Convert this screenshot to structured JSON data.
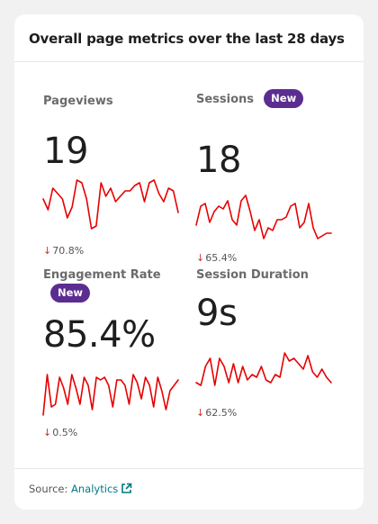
{
  "header": {
    "title": "Overall page metrics over the last 28 days"
  },
  "metrics": [
    {
      "label": "Pageviews",
      "badge": "",
      "value": "19",
      "change": "70.8%",
      "trend": "down",
      "sparkline": [
        0.65,
        0.45,
        0.85,
        0.75,
        0.65,
        0.3,
        0.5,
        1.0,
        0.95,
        0.65,
        0.1,
        0.15,
        0.95,
        0.7,
        0.85,
        0.6,
        0.7,
        0.8,
        0.8,
        0.9,
        0.95,
        0.6,
        0.95,
        1.0,
        0.75,
        0.6,
        0.85,
        0.8,
        0.4
      ]
    },
    {
      "label": "Sessions",
      "badge": "New",
      "value": "18",
      "change": "65.4%",
      "trend": "down",
      "sparkline": [
        0.3,
        0.65,
        0.7,
        0.35,
        0.55,
        0.65,
        0.6,
        0.75,
        0.4,
        0.3,
        0.75,
        0.85,
        0.55,
        0.2,
        0.4,
        0.05,
        0.25,
        0.2,
        0.4,
        0.4,
        0.45,
        0.65,
        0.7,
        0.25,
        0.35,
        0.7,
        0.25,
        0.05,
        0.1,
        0.15,
        0.15
      ]
    },
    {
      "label": "Engagement Rate",
      "badge": "New",
      "value": "85.4%",
      "change": "0.5%",
      "trend": "down",
      "sparkline": [
        0.05,
        0.8,
        0.2,
        0.25,
        0.75,
        0.55,
        0.25,
        0.8,
        0.55,
        0.25,
        0.75,
        0.6,
        0.15,
        0.75,
        0.7,
        0.75,
        0.6,
        0.2,
        0.7,
        0.7,
        0.6,
        0.25,
        0.8,
        0.65,
        0.35,
        0.75,
        0.6,
        0.2,
        0.75,
        0.5,
        0.15,
        0.5,
        0.6,
        0.7
      ]
    },
    {
      "label": "Session Duration",
      "badge": "",
      "value": "9s",
      "change": "62.5%",
      "trend": "down",
      "sparkline": [
        0.35,
        0.3,
        0.65,
        0.8,
        0.3,
        0.8,
        0.65,
        0.35,
        0.7,
        0.35,
        0.65,
        0.4,
        0.5,
        0.45,
        0.65,
        0.4,
        0.35,
        0.5,
        0.45,
        0.9,
        0.75,
        0.8,
        0.7,
        0.6,
        0.85,
        0.55,
        0.45,
        0.6,
        0.45,
        0.35
      ]
    }
  ],
  "footer": {
    "source_prefix": "Source: ",
    "source_link": "Analytics"
  },
  "colors": {
    "sparkline": "#e60000",
    "badge": "#5c2d91",
    "link": "#007a86",
    "down_arrow": "#c0392b"
  },
  "icons": {
    "trend_down": "↓",
    "external_link": "external-link-icon"
  }
}
